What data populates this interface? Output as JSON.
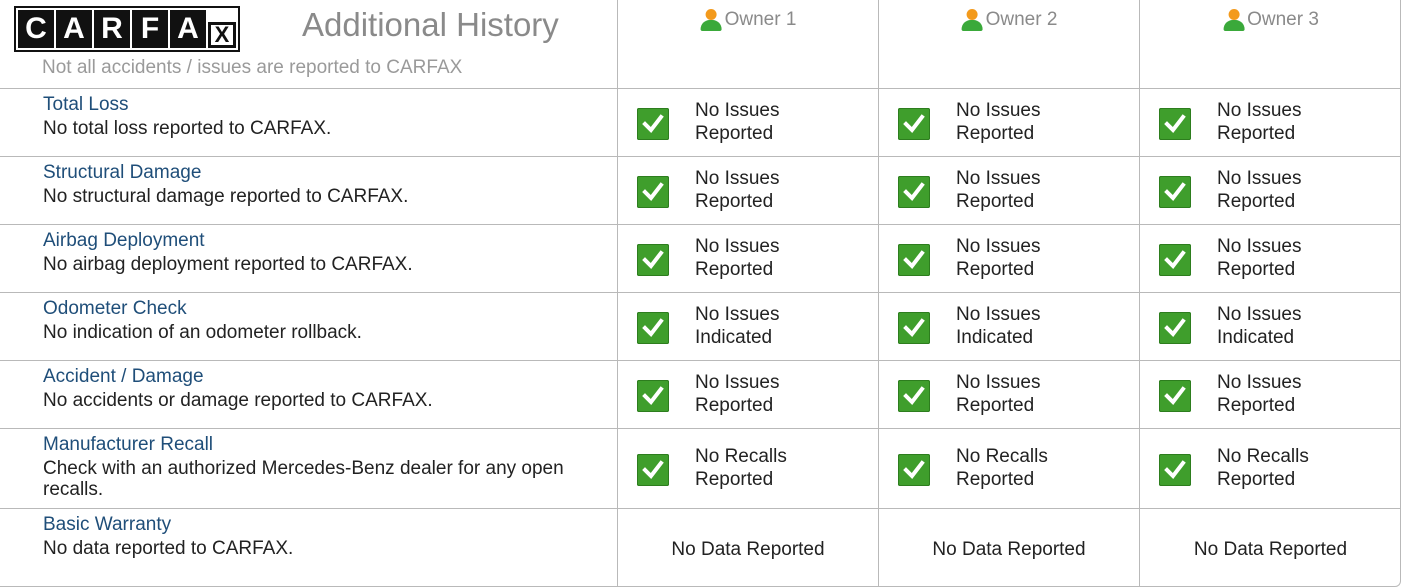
{
  "header": {
    "logo_letters": [
      "C",
      "A",
      "R",
      "F",
      "A",
      "X"
    ],
    "title": "Additional History",
    "subtitle": "Not all accidents / issues are reported to CARFAX",
    "owners": [
      "Owner 1",
      "Owner 2",
      "Owner 3"
    ]
  },
  "colors": {
    "check_green": "#3f9e2c",
    "label_blue": "#1f4e79",
    "muted_gray": "#8a8a8a"
  },
  "rows": [
    {
      "label": "Total Loss",
      "desc": "No total loss reported to CARFAX.",
      "status": [
        "No Issues",
        "Reported"
      ],
      "check": true
    },
    {
      "label": "Structural Damage",
      "desc": "No structural damage reported to CARFAX.",
      "status": [
        "No Issues",
        "Reported"
      ],
      "check": true
    },
    {
      "label": "Airbag Deployment",
      "desc": "No airbag deployment reported to CARFAX.",
      "status": [
        "No Issues",
        "Reported"
      ],
      "check": true
    },
    {
      "label": "Odometer Check",
      "desc": "No indication of an odometer rollback.",
      "status": [
        "No Issues",
        "Indicated"
      ],
      "check": true
    },
    {
      "label": "Accident / Damage",
      "desc": "No accidents or damage reported to CARFAX.",
      "status": [
        "No Issues",
        "Reported"
      ],
      "check": true
    },
    {
      "label": "Manufacturer Recall",
      "desc": "Check with an authorized Mercedes-Benz dealer for any open recalls.",
      "status": [
        "No Recalls",
        "Reported"
      ],
      "check": true
    },
    {
      "label": "Basic Warranty",
      "desc": "No data reported to CARFAX.",
      "status_single": "No Data Reported",
      "check": false
    }
  ]
}
